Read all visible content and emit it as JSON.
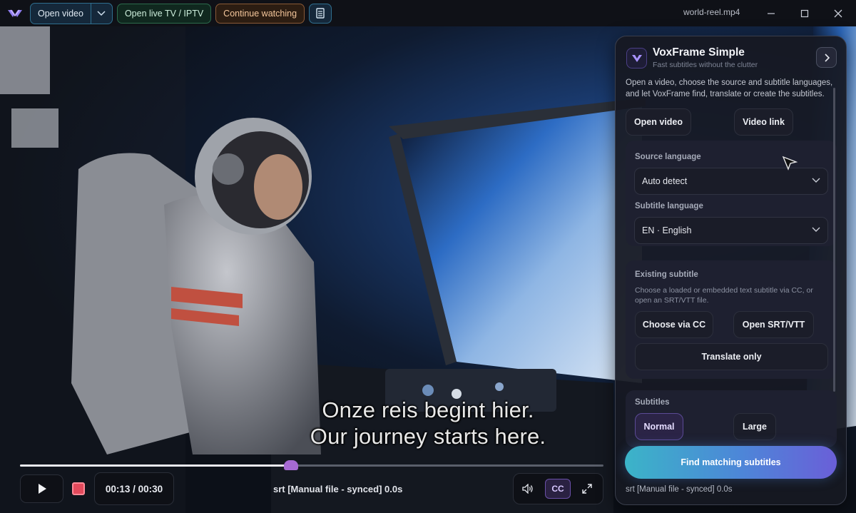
{
  "topbar": {
    "open_video_label": "Open video",
    "live_tv_label": "Open live TV / IPTV",
    "continue_label": "Continue watching",
    "file_name": "world-reel.mp4"
  },
  "video": {
    "subtitle_line1": "Onze reis begint hier.",
    "subtitle_line2": "Our journey starts here.",
    "progress_fraction": 0.465
  },
  "controls": {
    "time": "00:13 / 00:30",
    "subtitle_status": "srt [Manual file - synced] 0.0s",
    "cc_label": "CC"
  },
  "panel": {
    "title": "VoxFrame Simple",
    "subtitle": "Fast subtitles without the clutter",
    "intro": "Open a video, choose the source and subtitle languages, and let VoxFrame find, translate or create the subtitles.",
    "open_video_label": "Open video",
    "video_link_label": "Video link",
    "source_language_label": "Source language",
    "source_language_value": "Auto detect",
    "subtitle_language_label": "Subtitle language",
    "subtitle_language_value": "EN · English",
    "existing_subtitle_label": "Existing subtitle",
    "existing_subtitle_help": "Choose a loaded or embedded text subtitle via CC, or open an SRT/VTT file.",
    "choose_cc_label": "Choose via CC",
    "open_srt_label": "Open SRT/VTT",
    "translate_only_label": "Translate only",
    "subtitles_label": "Subtitles",
    "size_normal_label": "Normal",
    "size_large_label": "Large",
    "find_button_label": "Find matching subtitles",
    "status": "srt [Manual file - synced] 0.0s"
  },
  "colors": {
    "accent_purple": "#a66ad3",
    "live_green": "#2c6b4c",
    "continue_orange": "#8a5a36",
    "stop_red": "#e24a5c"
  }
}
